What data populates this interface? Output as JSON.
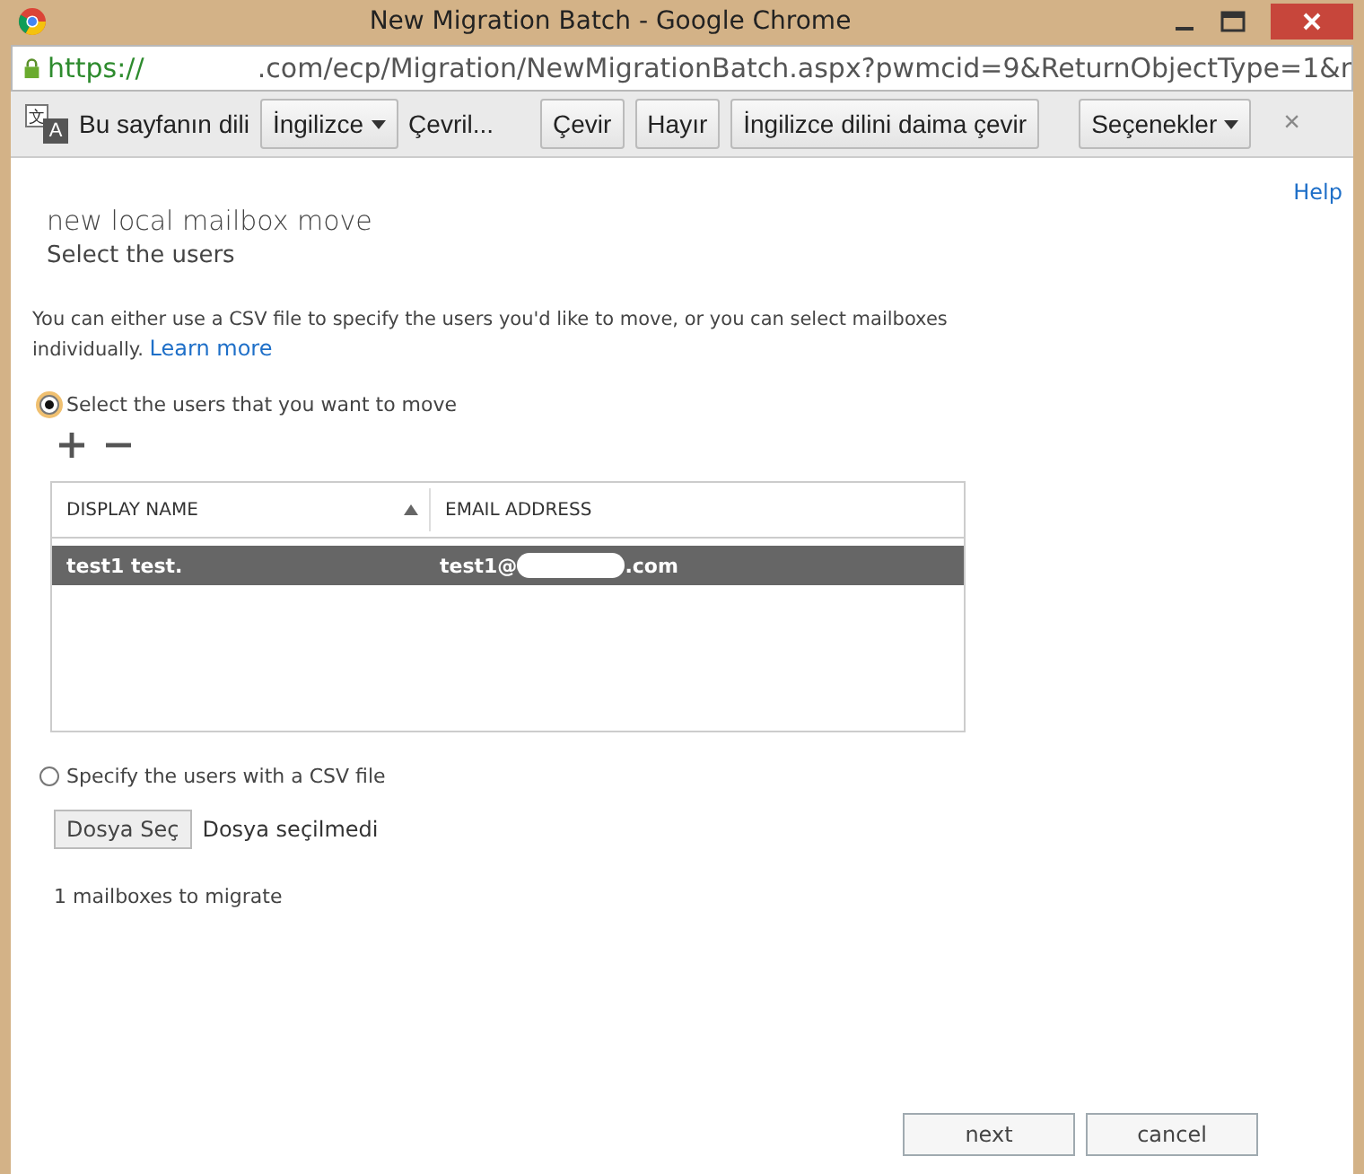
{
  "window": {
    "title": "New Migration Batch - Google Chrome"
  },
  "address_bar": {
    "scheme": "https://",
    "url_rest": ".com/ecp/Migration/NewMigrationBatch.aspx?pwmcid=9&ReturnObjectType=1&r"
  },
  "translate_bar": {
    "icon_glyphs": [
      "文",
      "A"
    ],
    "label": "Bu sayfanın dili",
    "language": "İngilizce",
    "status": "Çevril...",
    "buttons": [
      "Çevir",
      "Hayır",
      "İngilizce dilini daima çevir"
    ],
    "options": "Seçenekler",
    "close": "×"
  },
  "help_link": "Help",
  "heading": "new local mailbox move",
  "subheading": "Select the users",
  "intro": "You can either use a CSV file to specify the users you'd like to move, or you can select mailboxes individually.",
  "learn_more": "Learn more",
  "radios": [
    {
      "label": "Select the users that you want to move",
      "selected": true
    },
    {
      "label": "Specify the users with a CSV file",
      "selected": false
    }
  ],
  "table": {
    "columns": [
      {
        "label": "DISPLAY NAME",
        "sorted": true
      },
      {
        "label": "EMAIL ADDRESS",
        "sorted": false
      }
    ],
    "rows": [
      {
        "display_name": "test1 test.",
        "email_start": "test1@",
        "email_end": ".com",
        "selected": true
      }
    ]
  },
  "file_picker": {
    "button": "Dosya Seç",
    "status": "Dosya seçilmedi"
  },
  "count": "1 mailboxes to migrate",
  "buttons": [
    "next",
    "cancel"
  ]
}
